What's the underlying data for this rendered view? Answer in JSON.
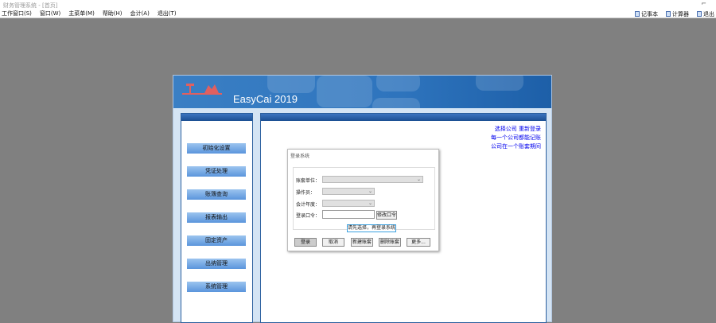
{
  "window": {
    "title": "财务管理系统 - [首页]",
    "controls": "⌐"
  },
  "menu": [
    "工作窗口(S)",
    "窗口(W)",
    "主菜单(M)",
    "帮助(H)",
    "会计(A)",
    "退出(T)"
  ],
  "tools": [
    "记事本",
    "计算器",
    "退出"
  ],
  "header": {
    "brand": "EasyCai 2019",
    "logo": "财务"
  },
  "sidebar": [
    "初始化设置",
    "凭证处理",
    "账簿查询",
    "报表输出",
    "固定资产",
    "出纳管理",
    "系统管理"
  ],
  "links": [
    "选择公司 重新登录",
    "每一个公司都能记账",
    "公司在一个账套期间"
  ],
  "dialog": {
    "title": "登录系统",
    "fields": [
      {
        "label": "账套单位：",
        "value": ""
      },
      {
        "label": "操作员：",
        "value": ""
      },
      {
        "label": "会计年度：",
        "value": ""
      }
    ],
    "password_label": "登录口令：",
    "change_password": "修改口令",
    "tooltip": "请先选择，再登录系统",
    "buttons": [
      "登录",
      "取消",
      "新建账套",
      "删除账套",
      "更多..."
    ]
  },
  "colors": {
    "background": "#808080",
    "accent": "#2e74bd",
    "link": "#0000ee"
  }
}
